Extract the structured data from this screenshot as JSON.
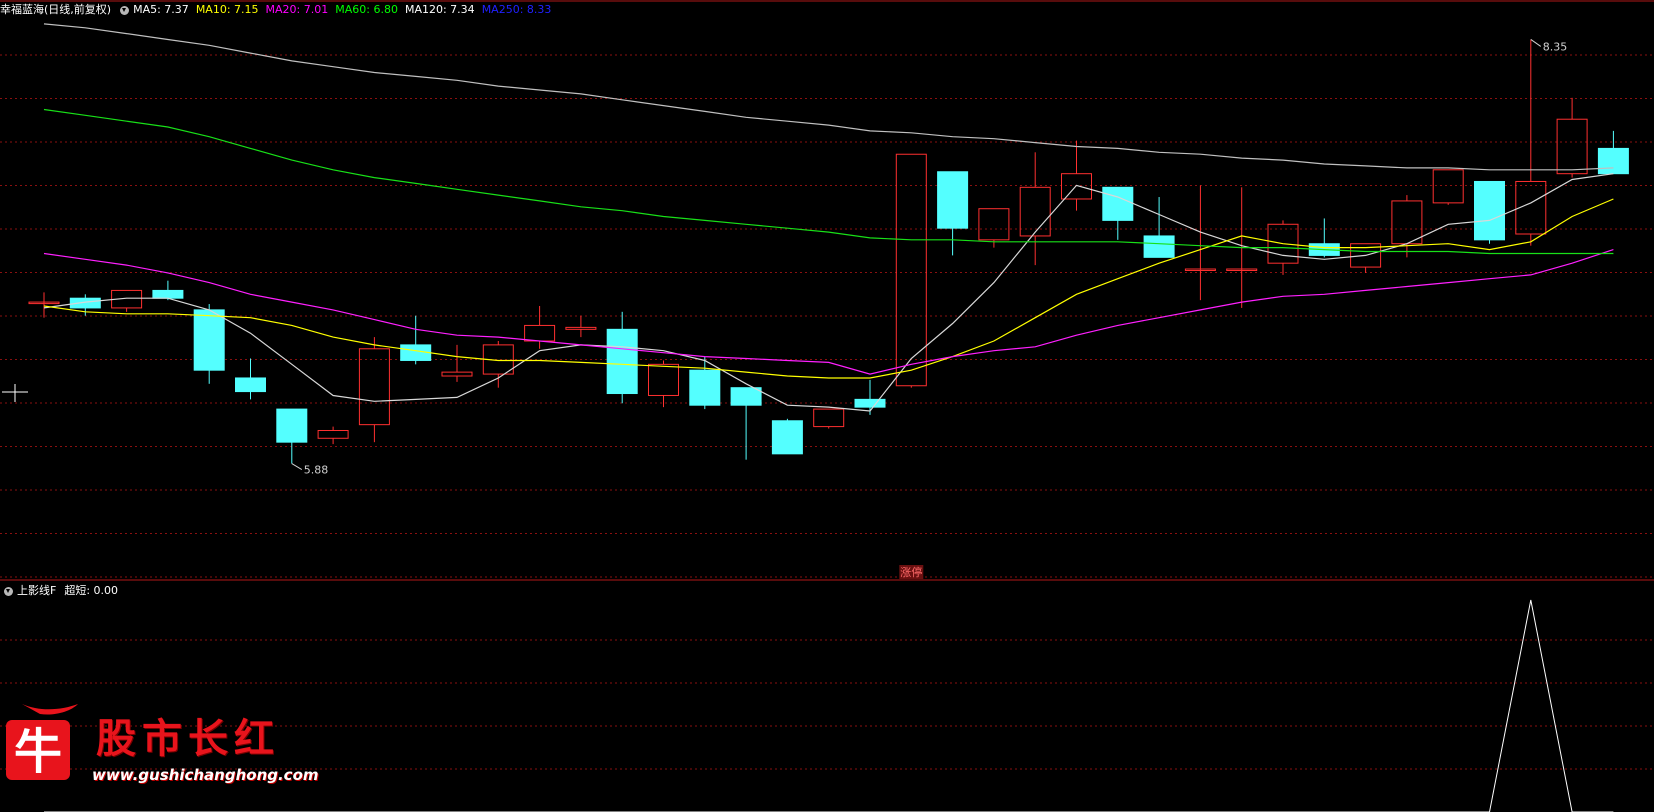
{
  "main_legend": {
    "title": "幸福蓝海(日线,前复权)",
    "items": [
      {
        "label": "MA5: 7.37",
        "color": "#ffffff"
      },
      {
        "label": "MA10: 7.15",
        "color": "#ffff00"
      },
      {
        "label": "MA20: 7.01",
        "color": "#ff00ff"
      },
      {
        "label": "MA60: 6.80",
        "color": "#00ff00"
      },
      {
        "label": "MA120: 7.34",
        "color": "#ffffff"
      },
      {
        "label": "MA250: 8.33",
        "color": "#2020ff"
      }
    ]
  },
  "sub_legend": {
    "title": "上影线F",
    "items": [
      {
        "label": "超短: 0.00",
        "color": "#ffffff"
      }
    ]
  },
  "marker_label": "涨停",
  "watermark": {
    "logo_char": "牛",
    "text": "股市长红",
    "url": "www.gushichanghong.com"
  },
  "chart_data": [
    {
      "type": "candlestick",
      "ylim": [
        5.7,
        8.45
      ],
      "grid": true,
      "up_color": "#ff3030",
      "down_color": "#54ffff",
      "candles": [
        {
          "o": 7.0,
          "h": 7.05,
          "l": 6.92,
          "c": 7.0
        },
        {
          "o": 7.02,
          "h": 7.04,
          "l": 6.93,
          "c": 6.97
        },
        {
          "o": 6.97,
          "h": 7.06,
          "l": 6.95,
          "c": 7.06
        },
        {
          "o": 7.06,
          "h": 7.11,
          "l": 7.01,
          "c": 7.02
        },
        {
          "o": 6.96,
          "h": 6.99,
          "l": 6.58,
          "c": 6.65
        },
        {
          "o": 6.61,
          "h": 6.71,
          "l": 6.5,
          "c": 6.54
        },
        {
          "o": 6.45,
          "h": 6.45,
          "l": 6.17,
          "c": 6.28
        },
        {
          "o": 6.3,
          "h": 6.36,
          "l": 6.27,
          "c": 6.34
        },
        {
          "o": 6.37,
          "h": 6.82,
          "l": 6.28,
          "c": 6.76
        },
        {
          "o": 6.78,
          "h": 6.93,
          "l": 6.68,
          "c": 6.7
        },
        {
          "o": 6.62,
          "h": 6.78,
          "l": 6.59,
          "c": 6.64
        },
        {
          "o": 6.63,
          "h": 6.8,
          "l": 6.56,
          "c": 6.78
        },
        {
          "o": 6.8,
          "h": 6.98,
          "l": 6.76,
          "c": 6.88
        },
        {
          "o": 6.86,
          "h": 6.93,
          "l": 6.82,
          "c": 6.87
        },
        {
          "o": 6.86,
          "h": 6.95,
          "l": 6.48,
          "c": 6.53
        },
        {
          "o": 6.52,
          "h": 6.7,
          "l": 6.46,
          "c": 6.68
        },
        {
          "o": 6.65,
          "h": 6.72,
          "l": 6.45,
          "c": 6.47
        },
        {
          "o": 6.56,
          "h": 6.56,
          "l": 6.19,
          "c": 6.47
        },
        {
          "o": 6.39,
          "h": 6.4,
          "l": 6.22,
          "c": 6.22
        },
        {
          "o": 6.36,
          "h": 6.45,
          "l": 6.35,
          "c": 6.45
        },
        {
          "o": 6.5,
          "h": 6.6,
          "l": 6.42,
          "c": 6.46
        },
        {
          "o": 6.57,
          "h": 7.76,
          "l": 6.56,
          "c": 7.76
        },
        {
          "o": 7.67,
          "h": 7.67,
          "l": 7.24,
          "c": 7.38
        },
        {
          "o": 7.32,
          "h": 7.48,
          "l": 7.28,
          "c": 7.48
        },
        {
          "o": 7.34,
          "h": 7.77,
          "l": 7.19,
          "c": 7.59
        },
        {
          "o": 7.53,
          "h": 7.83,
          "l": 7.47,
          "c": 7.66
        },
        {
          "o": 7.59,
          "h": 7.59,
          "l": 7.32,
          "c": 7.42
        },
        {
          "o": 7.34,
          "h": 7.54,
          "l": 7.29,
          "c": 7.23
        },
        {
          "o": 7.17,
          "h": 7.6,
          "l": 7.01,
          "c": 7.17
        },
        {
          "o": 7.17,
          "h": 7.59,
          "l": 6.97,
          "c": 7.17
        },
        {
          "o": 7.2,
          "h": 7.42,
          "l": 7.14,
          "c": 7.4
        },
        {
          "o": 7.3,
          "h": 7.43,
          "l": 7.23,
          "c": 7.24
        },
        {
          "o": 7.18,
          "h": 7.3,
          "l": 7.15,
          "c": 7.3
        },
        {
          "o": 7.3,
          "h": 7.55,
          "l": 7.23,
          "c": 7.52
        },
        {
          "o": 7.51,
          "h": 7.68,
          "l": 7.5,
          "c": 7.68
        },
        {
          "o": 7.62,
          "h": 7.62,
          "l": 7.3,
          "c": 7.32
        },
        {
          "o": 7.35,
          "h": 8.35,
          "l": 7.29,
          "c": 7.62
        },
        {
          "o": 7.66,
          "h": 8.05,
          "l": 7.64,
          "c": 7.94
        },
        {
          "o": 7.79,
          "h": 7.88,
          "l": 7.66,
          "c": 7.66
        }
      ],
      "series": [
        {
          "name": "MA5",
          "color": "#d8d8d8",
          "values": [
            6.97,
            7.0,
            7.02,
            7.02,
            6.96,
            6.84,
            6.68,
            6.52,
            6.49,
            6.5,
            6.51,
            6.61,
            6.75,
            6.78,
            6.77,
            6.75,
            6.7,
            6.58,
            6.47,
            6.46,
            6.44,
            6.71,
            6.89,
            7.1,
            7.36,
            7.6,
            7.54,
            7.45,
            7.36,
            7.29,
            7.24,
            7.22,
            7.24,
            7.3,
            7.4,
            7.42,
            7.51,
            7.63,
            7.66
          ]
        },
        {
          "name": "MA10",
          "color": "#ffff00",
          "values": [
            6.98,
            6.95,
            6.94,
            6.94,
            6.93,
            6.92,
            6.88,
            6.82,
            6.78,
            6.75,
            6.72,
            6.7,
            6.7,
            6.69,
            6.68,
            6.67,
            6.66,
            6.64,
            6.62,
            6.61,
            6.61,
            6.65,
            6.72,
            6.8,
            6.92,
            7.04,
            7.12,
            7.2,
            7.27,
            7.34,
            7.3,
            7.28,
            7.28,
            7.29,
            7.3,
            7.27,
            7.31,
            7.44,
            7.53
          ]
        },
        {
          "name": "MA20",
          "color": "#ff20ff",
          "values": [
            7.25,
            7.22,
            7.19,
            7.15,
            7.1,
            7.04,
            7.0,
            6.96,
            6.91,
            6.86,
            6.83,
            6.82,
            6.8,
            6.78,
            6.76,
            6.74,
            6.72,
            6.71,
            6.7,
            6.69,
            6.63,
            6.68,
            6.72,
            6.75,
            6.77,
            6.83,
            6.88,
            6.92,
            6.96,
            7.0,
            7.03,
            7.04,
            7.06,
            7.08,
            7.1,
            7.12,
            7.14,
            7.2,
            7.27
          ]
        },
        {
          "name": "MA60",
          "color": "#18e018",
          "values": [
            7.99,
            7.96,
            7.93,
            7.9,
            7.85,
            7.79,
            7.73,
            7.68,
            7.64,
            7.61,
            7.58,
            7.55,
            7.52,
            7.49,
            7.47,
            7.44,
            7.42,
            7.4,
            7.38,
            7.36,
            7.33,
            7.32,
            7.32,
            7.31,
            7.31,
            7.31,
            7.31,
            7.3,
            7.29,
            7.28,
            7.28,
            7.27,
            7.26,
            7.26,
            7.26,
            7.25,
            7.25,
            7.25,
            7.25
          ]
        },
        {
          "name": "MA120",
          "color": "#c0c0c0",
          "values": [
            8.43,
            8.41,
            8.38,
            8.35,
            8.32,
            8.28,
            8.24,
            8.21,
            8.18,
            8.16,
            8.14,
            8.11,
            8.09,
            8.07,
            8.04,
            8.01,
            7.98,
            7.95,
            7.93,
            7.91,
            7.88,
            7.87,
            7.85,
            7.84,
            7.82,
            7.8,
            7.79,
            7.77,
            7.76,
            7.74,
            7.73,
            7.71,
            7.7,
            7.69,
            7.69,
            7.68,
            7.68,
            7.68,
            7.69
          ]
        }
      ],
      "annotations": [
        {
          "label": "8.35",
          "candle": 36,
          "at": "high"
        },
        {
          "label": "5.88",
          "candle": 6,
          "at": "low"
        }
      ]
    },
    {
      "type": "line",
      "name": "超短",
      "ylim": [
        0,
        1
      ],
      "series": [
        {
          "name": "超短",
          "color": "#ffffff",
          "values": [
            0,
            0,
            0,
            0,
            0,
            0,
            0,
            0,
            0,
            0,
            0,
            0,
            0,
            0,
            0,
            0,
            0,
            0,
            0,
            0,
            0,
            0,
            0,
            0,
            0,
            0,
            0,
            0,
            0,
            0,
            0,
            0,
            0,
            0,
            0,
            0,
            1,
            0,
            0
          ]
        }
      ]
    }
  ]
}
